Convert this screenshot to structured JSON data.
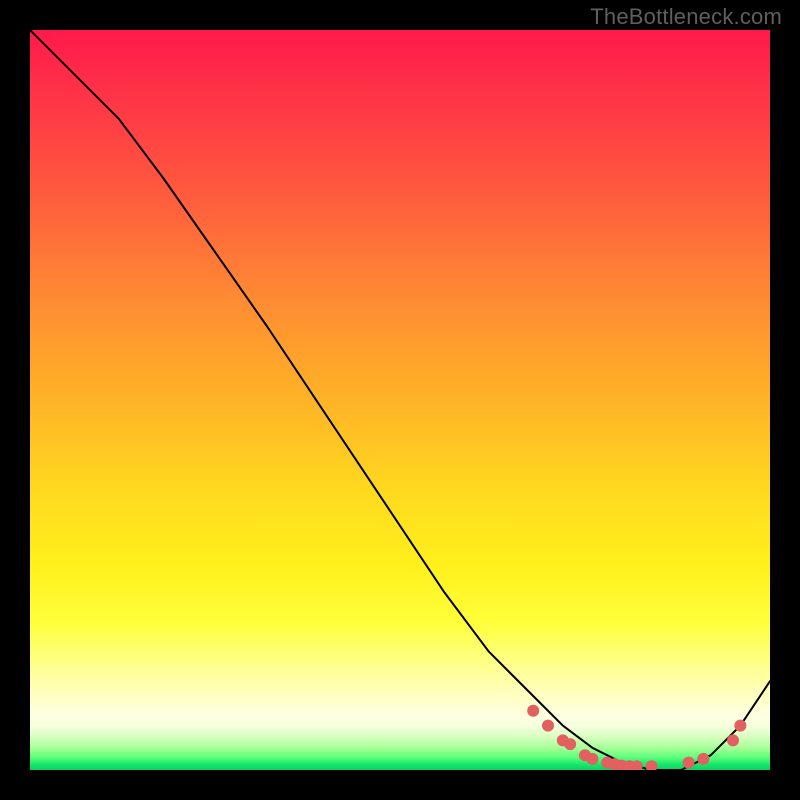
{
  "watermark": "TheBottleneck.com",
  "chart_data": {
    "type": "line",
    "title": "",
    "xlabel": "",
    "ylabel": "",
    "xlim": [
      0,
      100
    ],
    "ylim": [
      0,
      100
    ],
    "grid": false,
    "legend": false,
    "series": [
      {
        "name": "bottleneck-curve",
        "x": [
          0,
          3,
          7,
          12,
          18,
          25,
          32,
          40,
          48,
          56,
          62,
          68,
          72,
          76,
          80,
          84,
          88,
          92,
          96,
          100
        ],
        "y": [
          100,
          97,
          93,
          88,
          80,
          70,
          60,
          48,
          36,
          24,
          16,
          10,
          6,
          3,
          1,
          0,
          0,
          2,
          6,
          12
        ]
      }
    ],
    "markers": {
      "name": "scatter-points",
      "color": "#e2605f",
      "x": [
        68,
        70,
        72,
        73,
        75,
        76,
        78,
        79,
        80,
        81,
        82,
        84,
        89,
        91,
        95,
        96
      ],
      "y": [
        8,
        6,
        4,
        3.5,
        2,
        1.5,
        1,
        0.8,
        0.6,
        0.5,
        0.5,
        0.5,
        1,
        1.5,
        4,
        6
      ]
    },
    "background_gradient": {
      "orientation": "vertical",
      "stops": [
        {
          "pos": 0.0,
          "color": "#ff1a4b"
        },
        {
          "pos": 0.5,
          "color": "#ffb327"
        },
        {
          "pos": 0.8,
          "color": "#ffff3a"
        },
        {
          "pos": 0.93,
          "color": "#ffffe0"
        },
        {
          "pos": 1.0,
          "color": "#0ccf62"
        }
      ]
    }
  }
}
